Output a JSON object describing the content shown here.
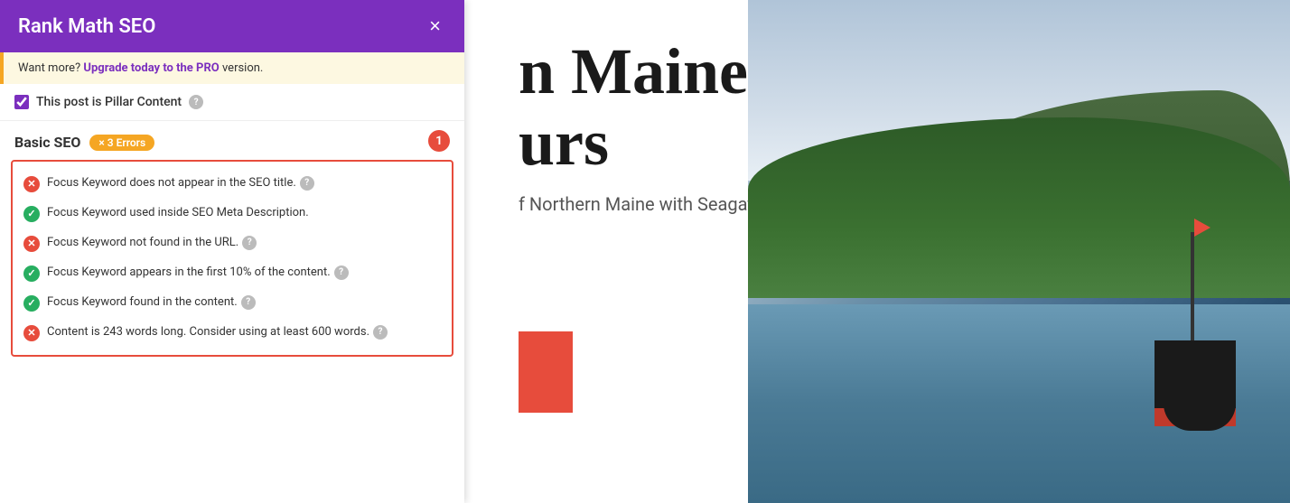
{
  "panel": {
    "header": {
      "title": "Rank Math SEO",
      "close_label": "×"
    },
    "upgrade_banner": {
      "text_before": "Want more? ",
      "link_text": "Upgrade today to the PRO",
      "text_after": " version."
    },
    "pillar": {
      "label": "This post is Pillar Content",
      "checked": true,
      "help": "?"
    },
    "basic_seo": {
      "title": "Basic SEO",
      "errors_badge": "× 3 Errors",
      "notification_count": "1",
      "checks": [
        {
          "type": "error",
          "text": "Focus Keyword does not appear in the SEO title.",
          "has_help": true
        },
        {
          "type": "success",
          "text": "Focus Keyword used inside SEO Meta Description.",
          "has_help": false
        },
        {
          "type": "error",
          "text": "Focus Keyword not found in the URL.",
          "has_help": true
        },
        {
          "type": "success",
          "text": "Focus Keyword appears in the first 10% of the content.",
          "has_help": true
        },
        {
          "type": "success",
          "text": "Focus Keyword found in the content.",
          "has_help": true
        },
        {
          "type": "error",
          "text": "Content is 243 words long. Consider using at least 600 words.",
          "has_help": true
        }
      ]
    }
  },
  "article": {
    "title_line1": "n Maine",
    "title_line2": "urs",
    "subtitle": "f Northern Maine with Seagate"
  },
  "icons": {
    "close": "×",
    "check": "✓",
    "x": "✕",
    "question": "?"
  }
}
